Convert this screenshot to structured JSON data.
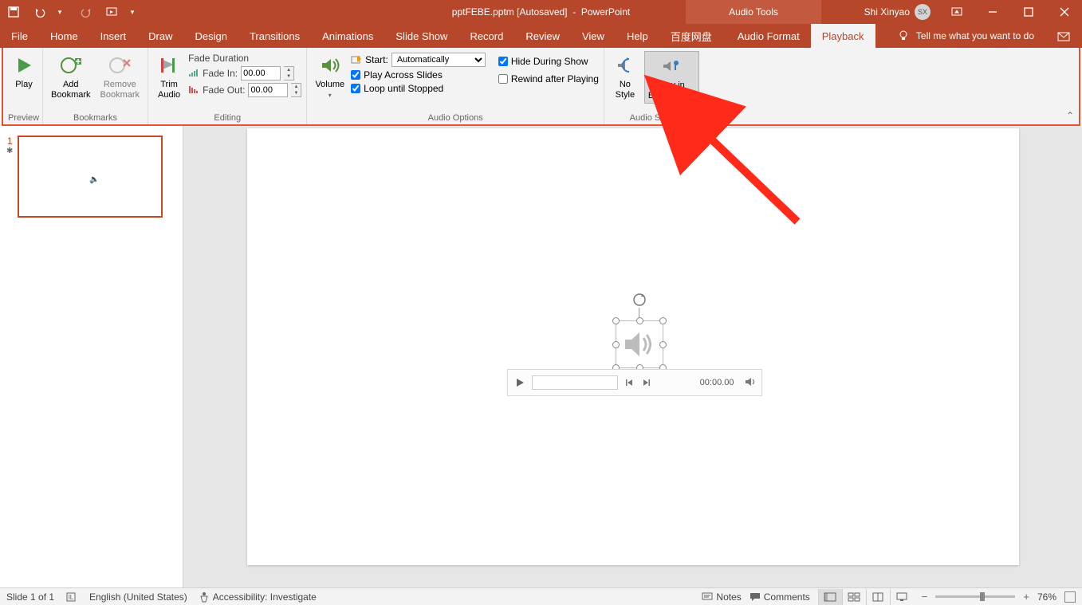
{
  "title": {
    "filename": "pptFEBE.pptm [Autosaved]",
    "app": "PowerPoint",
    "context_tab": "Audio Tools"
  },
  "user": {
    "name": "Shi Xinyao",
    "initials": "SX"
  },
  "tabs": {
    "file": "File",
    "home": "Home",
    "insert": "Insert",
    "draw": "Draw",
    "design": "Design",
    "transitions": "Transitions",
    "animations": "Animations",
    "slideshow": "Slide Show",
    "record": "Record",
    "review": "Review",
    "view": "View",
    "help": "Help",
    "baidu": "百度网盘",
    "audio_format": "Audio Format",
    "playback": "Playback"
  },
  "tell_me": "Tell me what you want to do",
  "ribbon": {
    "preview": {
      "play": "Play",
      "group": "Preview"
    },
    "bookmarks": {
      "add": "Add\nBookmark",
      "remove": "Remove\nBookmark",
      "group": "Bookmarks"
    },
    "editing": {
      "trim": "Trim\nAudio",
      "fade_duration": "Fade Duration",
      "fade_in_label": "Fade In:",
      "fade_in_value": "00.00",
      "fade_out_label": "Fade Out:",
      "fade_out_value": "00.00",
      "group": "Editing"
    },
    "audio_options": {
      "volume": "Volume",
      "start_label": "Start:",
      "start_value": "Automatically",
      "play_across": "Play Across Slides",
      "loop": "Loop until Stopped",
      "hide": "Hide During Show",
      "rewind": "Rewind after Playing",
      "group": "Audio Options"
    },
    "audio_styles": {
      "no_style": "No\nStyle",
      "play_bg": "Play in\nBackground",
      "group": "Audio Styles"
    }
  },
  "slide_panel": {
    "slide1_num": "1"
  },
  "player": {
    "time": "00:00.00"
  },
  "status": {
    "slide_info": "Slide 1 of 1",
    "language": "English (United States)",
    "accessibility": "Accessibility: Investigate",
    "notes": "Notes",
    "comments": "Comments",
    "zoom": "76%"
  }
}
